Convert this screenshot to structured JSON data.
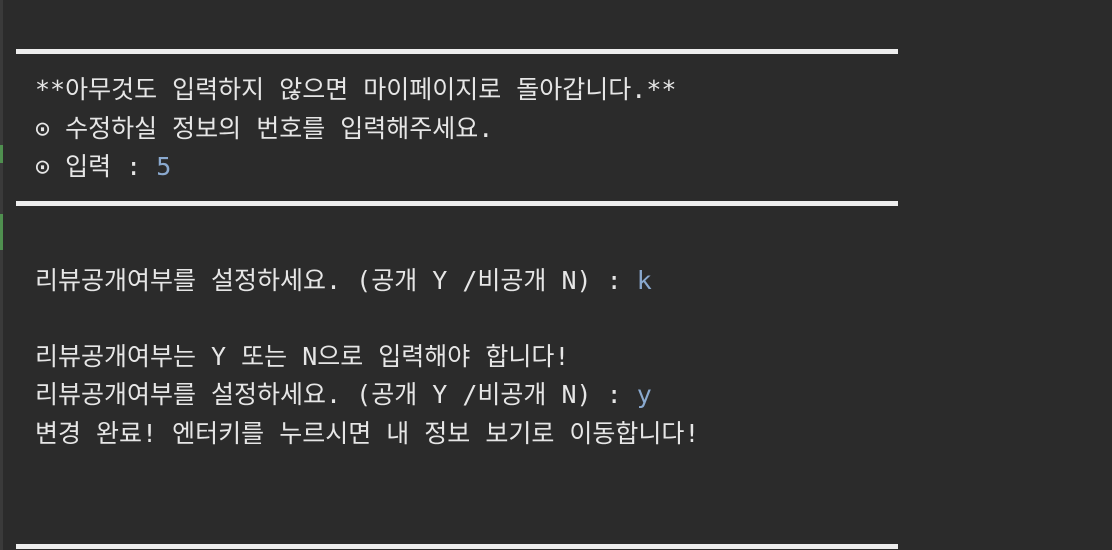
{
  "console": {
    "menu": {
      "notice": "**아무것도 입력하지 않으면 마이페이지로 돌아갑니다.**",
      "bullet": "⊙",
      "prompt_text": "수정하실 정보의 번호를 입력해주세요.",
      "input_label": "입력 : ",
      "input_value": "5"
    },
    "review": {
      "prompt1": "리뷰공개여부를 설정하세요. (공개 Y /비공개 N) : ",
      "input1": "k",
      "error": "리뷰공개여부는 Y 또는 N으로 입력해야 합니다!",
      "prompt2": "리뷰공개여부를 설정하세요. (공개 Y /비공개 N) : ",
      "input2": "y",
      "done": "변경 완료! 엔터키를 누르시면 내 정보 보기로 이동합니다!"
    },
    "colors": {
      "background": "#2b2b2b",
      "text": "#e6e6e6",
      "user_input": "#8aa9cf",
      "rule": "#ededed"
    }
  }
}
